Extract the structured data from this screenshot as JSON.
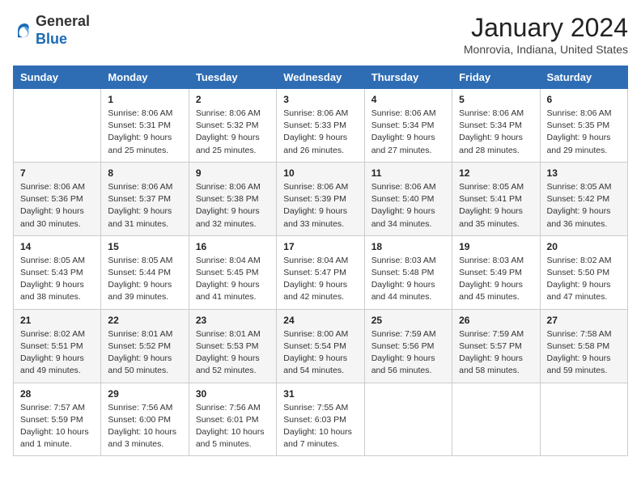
{
  "header": {
    "logo_general": "General",
    "logo_blue": "Blue",
    "month_title": "January 2024",
    "location": "Monrovia, Indiana, United States"
  },
  "days_of_week": [
    "Sunday",
    "Monday",
    "Tuesday",
    "Wednesday",
    "Thursday",
    "Friday",
    "Saturday"
  ],
  "weeks": [
    [
      {
        "day": "",
        "info": ""
      },
      {
        "day": "1",
        "info": "Sunrise: 8:06 AM\nSunset: 5:31 PM\nDaylight: 9 hours\nand 25 minutes."
      },
      {
        "day": "2",
        "info": "Sunrise: 8:06 AM\nSunset: 5:32 PM\nDaylight: 9 hours\nand 25 minutes."
      },
      {
        "day": "3",
        "info": "Sunrise: 8:06 AM\nSunset: 5:33 PM\nDaylight: 9 hours\nand 26 minutes."
      },
      {
        "day": "4",
        "info": "Sunrise: 8:06 AM\nSunset: 5:34 PM\nDaylight: 9 hours\nand 27 minutes."
      },
      {
        "day": "5",
        "info": "Sunrise: 8:06 AM\nSunset: 5:34 PM\nDaylight: 9 hours\nand 28 minutes."
      },
      {
        "day": "6",
        "info": "Sunrise: 8:06 AM\nSunset: 5:35 PM\nDaylight: 9 hours\nand 29 minutes."
      }
    ],
    [
      {
        "day": "7",
        "info": "Sunrise: 8:06 AM\nSunset: 5:36 PM\nDaylight: 9 hours\nand 30 minutes."
      },
      {
        "day": "8",
        "info": "Sunrise: 8:06 AM\nSunset: 5:37 PM\nDaylight: 9 hours\nand 31 minutes."
      },
      {
        "day": "9",
        "info": "Sunrise: 8:06 AM\nSunset: 5:38 PM\nDaylight: 9 hours\nand 32 minutes."
      },
      {
        "day": "10",
        "info": "Sunrise: 8:06 AM\nSunset: 5:39 PM\nDaylight: 9 hours\nand 33 minutes."
      },
      {
        "day": "11",
        "info": "Sunrise: 8:06 AM\nSunset: 5:40 PM\nDaylight: 9 hours\nand 34 minutes."
      },
      {
        "day": "12",
        "info": "Sunrise: 8:05 AM\nSunset: 5:41 PM\nDaylight: 9 hours\nand 35 minutes."
      },
      {
        "day": "13",
        "info": "Sunrise: 8:05 AM\nSunset: 5:42 PM\nDaylight: 9 hours\nand 36 minutes."
      }
    ],
    [
      {
        "day": "14",
        "info": "Sunrise: 8:05 AM\nSunset: 5:43 PM\nDaylight: 9 hours\nand 38 minutes."
      },
      {
        "day": "15",
        "info": "Sunrise: 8:05 AM\nSunset: 5:44 PM\nDaylight: 9 hours\nand 39 minutes."
      },
      {
        "day": "16",
        "info": "Sunrise: 8:04 AM\nSunset: 5:45 PM\nDaylight: 9 hours\nand 41 minutes."
      },
      {
        "day": "17",
        "info": "Sunrise: 8:04 AM\nSunset: 5:47 PM\nDaylight: 9 hours\nand 42 minutes."
      },
      {
        "day": "18",
        "info": "Sunrise: 8:03 AM\nSunset: 5:48 PM\nDaylight: 9 hours\nand 44 minutes."
      },
      {
        "day": "19",
        "info": "Sunrise: 8:03 AM\nSunset: 5:49 PM\nDaylight: 9 hours\nand 45 minutes."
      },
      {
        "day": "20",
        "info": "Sunrise: 8:02 AM\nSunset: 5:50 PM\nDaylight: 9 hours\nand 47 minutes."
      }
    ],
    [
      {
        "day": "21",
        "info": "Sunrise: 8:02 AM\nSunset: 5:51 PM\nDaylight: 9 hours\nand 49 minutes."
      },
      {
        "day": "22",
        "info": "Sunrise: 8:01 AM\nSunset: 5:52 PM\nDaylight: 9 hours\nand 50 minutes."
      },
      {
        "day": "23",
        "info": "Sunrise: 8:01 AM\nSunset: 5:53 PM\nDaylight: 9 hours\nand 52 minutes."
      },
      {
        "day": "24",
        "info": "Sunrise: 8:00 AM\nSunset: 5:54 PM\nDaylight: 9 hours\nand 54 minutes."
      },
      {
        "day": "25",
        "info": "Sunrise: 7:59 AM\nSunset: 5:56 PM\nDaylight: 9 hours\nand 56 minutes."
      },
      {
        "day": "26",
        "info": "Sunrise: 7:59 AM\nSunset: 5:57 PM\nDaylight: 9 hours\nand 58 minutes."
      },
      {
        "day": "27",
        "info": "Sunrise: 7:58 AM\nSunset: 5:58 PM\nDaylight: 9 hours\nand 59 minutes."
      }
    ],
    [
      {
        "day": "28",
        "info": "Sunrise: 7:57 AM\nSunset: 5:59 PM\nDaylight: 10 hours\nand 1 minute."
      },
      {
        "day": "29",
        "info": "Sunrise: 7:56 AM\nSunset: 6:00 PM\nDaylight: 10 hours\nand 3 minutes."
      },
      {
        "day": "30",
        "info": "Sunrise: 7:56 AM\nSunset: 6:01 PM\nDaylight: 10 hours\nand 5 minutes."
      },
      {
        "day": "31",
        "info": "Sunrise: 7:55 AM\nSunset: 6:03 PM\nDaylight: 10 hours\nand 7 minutes."
      },
      {
        "day": "",
        "info": ""
      },
      {
        "day": "",
        "info": ""
      },
      {
        "day": "",
        "info": ""
      }
    ]
  ]
}
